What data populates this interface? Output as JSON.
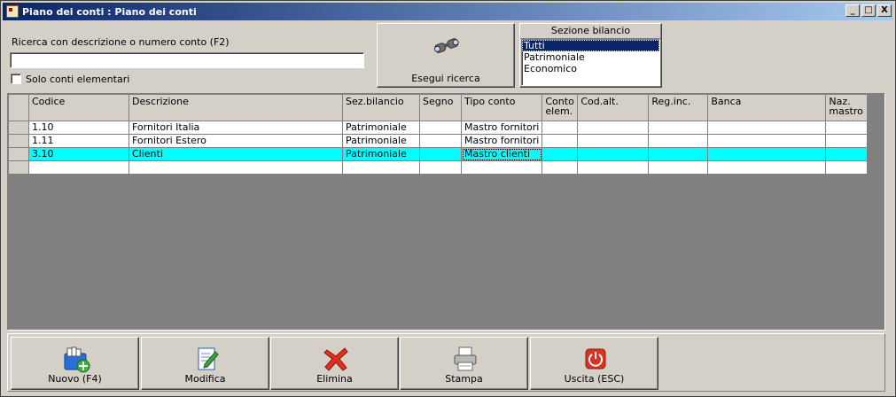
{
  "window": {
    "title": "Piano dei conti : Piano dei conti",
    "controls": [
      "_",
      "□",
      "X"
    ]
  },
  "search": {
    "label": "Ricerca con descrizione o numero conto (F2)",
    "value": "",
    "only_elementary_label": "Solo conti elementari",
    "only_elementary_checked": false,
    "button_label": "Esegui ricerca"
  },
  "sezione": {
    "header": "Sezione bilancio",
    "options": [
      "Tutti",
      "Patrimoniale",
      "Economico"
    ],
    "selected": "Tutti"
  },
  "grid": {
    "columns": [
      "Codice",
      "Descrizione",
      "Sez.bilancio",
      "Segno",
      "Tipo conto",
      "Conto elem.",
      "Cod.alt.",
      "Reg.inc.",
      "Banca",
      "Naz. mastro"
    ],
    "rows": [
      [
        "1.10",
        "Fornitori Italia",
        "Patrimoniale",
        "",
        "Mastro fornitori",
        "",
        "",
        "",
        "",
        ""
      ],
      [
        "1.11",
        "Fornitori Estero",
        "Patrimoniale",
        "",
        "Mastro fornitori",
        "",
        "",
        "",
        "",
        ""
      ],
      [
        "3.10",
        "Clienti",
        "Patrimoniale",
        "",
        "Mastro clienti",
        "",
        "",
        "",
        "",
        ""
      ],
      [
        "",
        "",
        "",
        "",
        "",
        "",
        "",
        "",
        "",
        ""
      ]
    ],
    "selected_row": 2,
    "colors": {
      "selected_row": "#00ffff",
      "grid_background": "#808080"
    }
  },
  "toolbar": {
    "new_label": "Nuovo (F4)",
    "edit_label": "Modifica",
    "delete_label": "Elimina",
    "print_label": "Stampa",
    "exit_label": "Uscita (ESC)"
  },
  "icons": {
    "new": "folder-add-icon",
    "edit": "edit-document-icon",
    "delete": "red-x-icon",
    "print": "printer-icon",
    "exit": "power-icon",
    "search": "binoculars-icon"
  }
}
